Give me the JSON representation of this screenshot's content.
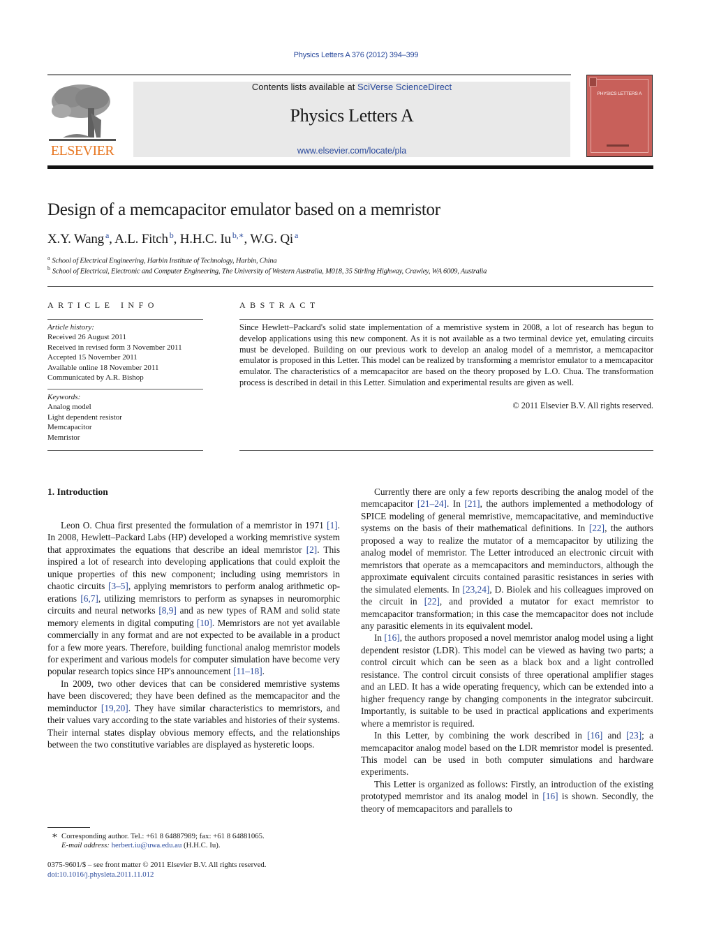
{
  "header": {
    "journal_reference": "Physics Letters A 376 (2012) 394–399",
    "contents_prefix": "Contents lists available at ",
    "contents_link": "SciVerse ScienceDirect",
    "journal_title": "Physics Letters A",
    "journal_url": "www.elsevier.com/locate/pla",
    "publisher_logo_text": "ELSEVIER",
    "publisher_logo_icon": "elsevier-tree-icon",
    "cover_title": "PHYSICS LETTERS A",
    "colors": {
      "link": "#2a4a9c",
      "elsevier_orange": "#e87722",
      "masthead_bg": "#e9e9e9",
      "cover_red": "#c8605a"
    }
  },
  "article": {
    "title": "Design of a memcapacitor emulator based on a memristor",
    "authors": [
      {
        "name": "X.Y. Wang",
        "marks": "a",
        "sep": ", "
      },
      {
        "name": "A.L. Fitch",
        "marks": "b",
        "sep": ", "
      },
      {
        "name": "H.H.C. Iu",
        "marks": "b,∗",
        "sep": ", "
      },
      {
        "name": "W.G. Qi",
        "marks": "a",
        "sep": ""
      }
    ],
    "affiliations": [
      {
        "mark": "a",
        "text": "School of Electrical Engineering, Harbin Institute of Technology, Harbin, China"
      },
      {
        "mark": "b",
        "text": "School of Electrical, Electronic and Computer Engineering, The University of Western Australia, M018, 35 Stirling Highway, Crawley, WA 6009, Australia"
      }
    ]
  },
  "article_info": {
    "heading": "ARTICLE INFO",
    "history_label": "Article history:",
    "history": [
      "Received 26 August 2011",
      "Received in revised form 3 November 2011",
      "Accepted 15 November 2011",
      "Available online 18 November 2011",
      "Communicated by A.R. Bishop"
    ],
    "keywords_label": "Keywords:",
    "keywords": [
      "Analog model",
      "Light dependent resistor",
      "Memcapacitor",
      "Memristor"
    ]
  },
  "abstract": {
    "heading": "ABSTRACT",
    "text": "Since Hewlett–Packard's solid state implementation of a memristive system in 2008, a lot of research has begun to develop applications using this new component. As it is not available as a two terminal device yet, emulating circuits must be developed. Building on our previous work to develop an analog model of a memristor, a memcapacitor emulator is proposed in this Letter. This model can be realized by transforming a memristor emulator to a memcapacitor emulator. The characteristics of a memcapacitor are based on the theory proposed by L.O. Chua. The transformation process is described in detail in this Letter. Simulation and experimental results are given as well.",
    "copyright": "© 2011 Elsevier B.V. All rights reserved."
  },
  "body": {
    "section_heading": "1.  Introduction",
    "left_paragraphs": [
      [
        {
          "t": "Leon O. Chua first presented the formulation of a memristor in 1971 "
        },
        {
          "ref": "[1]"
        },
        {
          "t": ". In 2008, Hewlett–Packard Labs (HP) developed a working memristive system that approximates the equations that describe an ideal memristor "
        },
        {
          "ref": "[2]"
        },
        {
          "t": ". This inspired a lot of research into de­veloping applications that could exploit the unique properties of this new component; including using memristors in chaotic cir­cuits "
        },
        {
          "ref": "[3–5]"
        },
        {
          "t": ", applying memristors to perform analog arithmetic op­erations "
        },
        {
          "ref": "[6,7]"
        },
        {
          "t": ", utilizing memristors to perform as synapses in neu­romorphic circuits and neural networks "
        },
        {
          "ref": "[8,9]"
        },
        {
          "t": " and as new types of RAM and solid state memory elements in digital computing "
        },
        {
          "ref": "[10]"
        },
        {
          "t": ". Memristors are not yet available commercially in any format and are not expected to be available in a product for a few more years. Therefore, building functional analog memristor models for exper­iment and various models for computer simulation have become very popular research topics since HP's announcement "
        },
        {
          "ref": "[11–18]"
        },
        {
          "t": "."
        }
      ],
      [
        {
          "t": "In 2009, two other devices that can be considered memris­tive systems have been discovered; they have been defined as the memcapacitor and the meminductor "
        },
        {
          "ref": "[19,20]"
        },
        {
          "t": ". They have sim­ilar characteristics to memristors, and their values vary according to the state variables and histories of their systems. Their inter­nal states display obvious memory effects, and the relationships between the two constitutive variables are displayed as hysteretic loops."
        }
      ]
    ],
    "right_paragraphs": [
      [
        {
          "t": "Currently there are only a few reports describing the analog model of the memcapacitor "
        },
        {
          "ref": "[21–24]"
        },
        {
          "t": ". In "
        },
        {
          "ref": "[21]"
        },
        {
          "t": ", the authors imple­mented a methodology of SPICE modeling of general memristive, memcapacitative, and meminductive systems on the basis of their mathematical definitions. In "
        },
        {
          "ref": "[22]"
        },
        {
          "t": ", the authors proposed a way to realize the mutator of a memcapacitor by utilizing the analog model of memristor. The Letter introduced an electronic circuit with memristors that operate as a memcapacitors and meminduc­tors, although the approximate equivalent circuits contained para­sitic resistances in series with the simulated elements. In "
        },
        {
          "ref": "[23,24]"
        },
        {
          "t": ", D. Biolek and his colleagues improved on the circuit in "
        },
        {
          "ref": "[22]"
        },
        {
          "t": ", and provided a mutator for exact memristor to memcapacitor trans­formation; in this case the memcapacitor does not include any parasitic elements in its equivalent model."
        }
      ],
      [
        {
          "t": "In "
        },
        {
          "ref": "[16]"
        },
        {
          "t": ", the authors proposed a novel memristor analog model using a light dependent resistor (LDR). This model can be viewed as having two parts; a control circuit which can be seen as a black box and a light controlled resistance. The control circuit consists of three operational amplifier stages and an LED. It has a wide operating frequency, which can be extended into a higher fre­quency range by changing components in the integrator subcircuit. Importantly, is suitable to be used in practical applications and ex­periments where a memristor is required."
        }
      ],
      [
        {
          "t": "In this Letter, by combining the work described in "
        },
        {
          "ref": "[16]"
        },
        {
          "t": " and "
        },
        {
          "ref": "[23]"
        },
        {
          "t": "; a memcapacitor analog model based on the LDR memristor model is presented. This model can be used in both computer simulations and hardware experiments."
        }
      ],
      [
        {
          "t": "This Letter is organized as follows: Firstly, an introduction of the existing prototyped memristor and its analog model in "
        },
        {
          "ref": "[16]"
        },
        {
          "t": " is shown. Secondly, the theory of memcapacitors and parallels to"
        }
      ]
    ]
  },
  "footnotes": {
    "corresponding_mark": "∗",
    "corresponding_text": "Corresponding author. Tel.: +61 8 64887989; fax: +61 8 64881065.",
    "email_label": "E-mail address:",
    "email": "herbert.iu@uwa.edu.au",
    "email_owner": " (H.H.C. Iu).",
    "issn_line": "0375-9601/$ – see front matter  © 2011 Elsevier B.V. All rights reserved.",
    "doi": "doi:10.1016/j.physleta.2011.11.012"
  }
}
